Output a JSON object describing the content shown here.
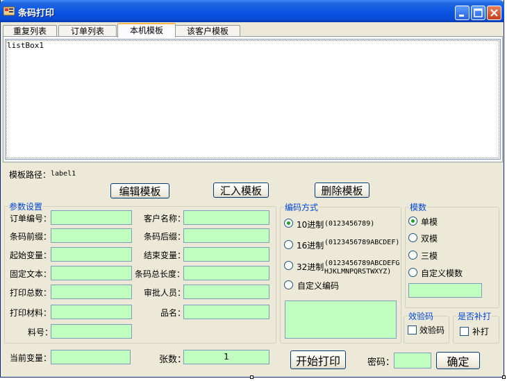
{
  "window": {
    "title": "条码打印"
  },
  "tabs": [
    {
      "label": "重复列表"
    },
    {
      "label": "订单列表"
    },
    {
      "label": "本机模板"
    },
    {
      "label": "该客户模板"
    }
  ],
  "listbox": {
    "text": "listBox1"
  },
  "template_path": {
    "label": "模板路径：",
    "value": "label1"
  },
  "buttons": {
    "edit_template": "编辑模板",
    "import_template": "汇入模板",
    "delete_template": "删除模板",
    "start_print": "开始打印",
    "confirm": "确定"
  },
  "params": {
    "legend": "参数设置",
    "order_no": "订单编号：",
    "barcode_prefix": "条码前缀：",
    "start_var": "起始变量：",
    "fixed_text": "固定文本：",
    "print_total": "打印总数：",
    "print_material": "打印材料：",
    "part_no": "料号：",
    "customer_name": "客户名称：",
    "barcode_suffix": "条码后缀：",
    "end_var": "结束变量：",
    "barcode_length": "条码总长度：",
    "approver": "审批人员：",
    "product_name": "品名："
  },
  "encoding": {
    "legend": "编码方式",
    "opt1": "10进制",
    "opt1_hint": "(0123456789)",
    "opt2": "16进制",
    "opt2_hint": "(0123456789ABCDEF)",
    "opt3": "32进制",
    "opt3_hint_line1": "(0123456789ABCDEFG",
    "opt3_hint_line2": "HJKLMNPQRSTWXYZ)",
    "opt4": "自定义编码",
    "selected": "10进制"
  },
  "modulus": {
    "legend": "模数",
    "opt1": "单模",
    "opt2": "双模",
    "opt3": "三模",
    "opt4": "自定义模数",
    "selected": "单模"
  },
  "checksum": {
    "legend": "效验码",
    "checkbox": "效验码"
  },
  "reprint": {
    "legend": "是否补打",
    "checkbox": "补打"
  },
  "bottom": {
    "current_var_label": "当前变量：",
    "sheets_label": "张数：",
    "sheets_value": "1",
    "password_label": "密码："
  },
  "colors": {
    "field_bg": "#c0ffc0",
    "legend": "#0046d5",
    "titlebar": "#0a54e3",
    "window_bg": "#ece9d8"
  }
}
